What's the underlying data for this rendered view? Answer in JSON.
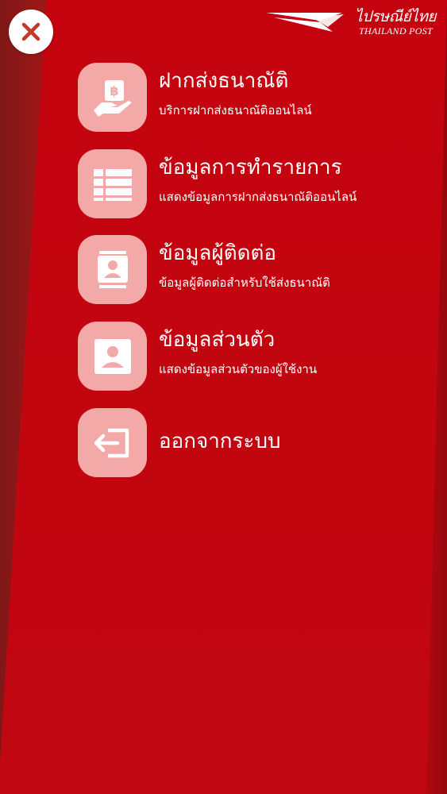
{
  "logo": {
    "thai": "ไปรษณีย์ไทย",
    "english": "THAILAND POST"
  },
  "menu": {
    "items": [
      {
        "title": "ฝากส่งธนาณัติ",
        "subtitle": "บริการฝากส่งธนาณัติออนไลน์",
        "icon": "hand-baht-icon"
      },
      {
        "title": "ข้อมูลการทำรายการ",
        "subtitle": "แสดงข้อมูลการฝากส่งธนาณัติออนไลน์",
        "icon": "list-table-icon"
      },
      {
        "title": "ข้อมูลผู้ติดต่อ",
        "subtitle": "ข้อมูลผู้ติดต่อสำหรับใช้ส่งธนาณัติ",
        "icon": "contact-book-icon"
      },
      {
        "title": "ข้อมูลส่วนตัว",
        "subtitle": "แสดงข้อมูลส่วนตัวของผู้ใช้งาน",
        "icon": "profile-card-icon"
      },
      {
        "title": "ออกจากระบบ",
        "subtitle": "",
        "icon": "logout-icon"
      }
    ]
  },
  "colors": {
    "panel": "#c4030f",
    "icon_tile": "#f4a9a9",
    "close_x": "#c0392b",
    "text": "#ffffff"
  }
}
